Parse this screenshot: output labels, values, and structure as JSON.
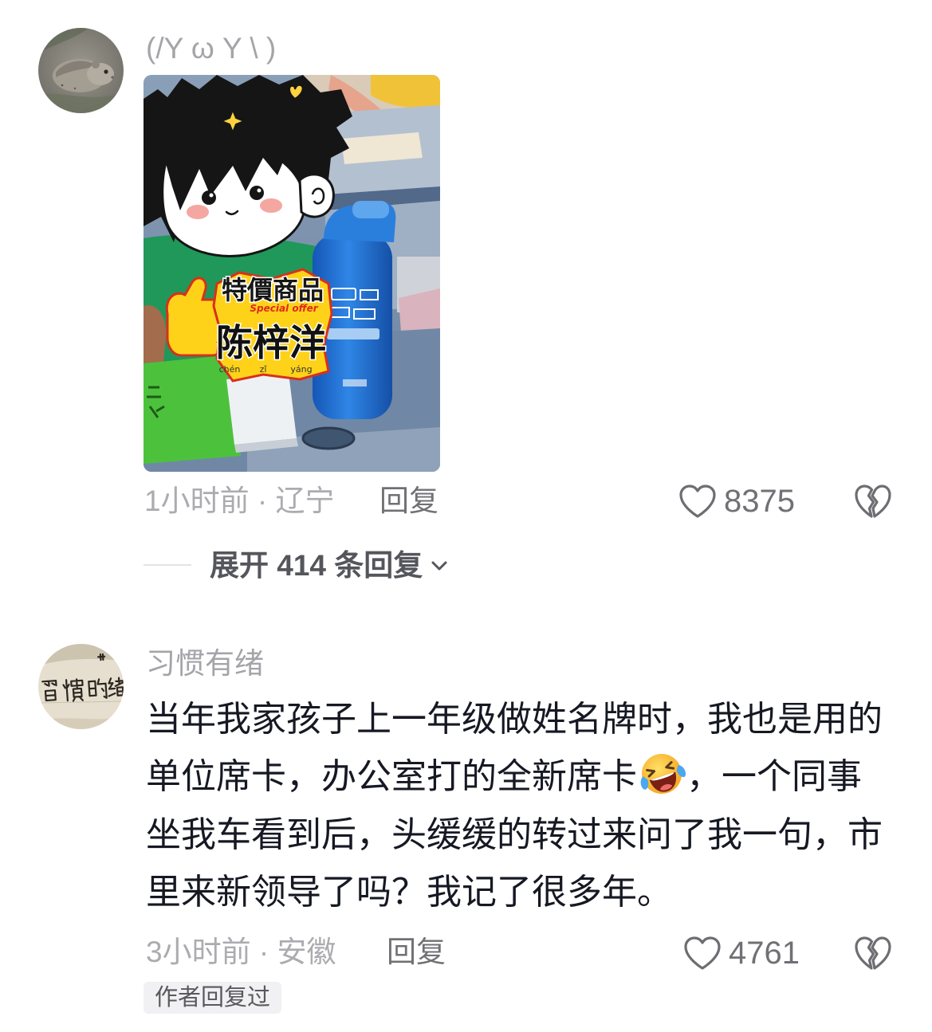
{
  "colors": {
    "text_primary": "#161823",
    "text_secondary": "#a4a4a9",
    "text_tertiary": "#ababb0",
    "text_action": "#707075",
    "text_expand": "#55555c",
    "icon_stroke": "#6d6d72",
    "badge_bg": "#f1f1f3"
  },
  "comments": [
    {
      "avatar": "hamster-photo-avatar",
      "username": "(/Y ω Y \\ )",
      "photo": {
        "sticker_title": "特價商品",
        "sticker_tagline": "Special offer",
        "sticker_name": "陈梓洋",
        "sticker_pinyin": [
          "chén",
          "zǐ",
          "yáng"
        ]
      },
      "meta": "1小时前 · 辽宁",
      "reply_label": "回复",
      "like_icon": "heart-outline-icon",
      "like_count": "8375",
      "dislike_icon": "broken-heart-icon",
      "expand_label": "展开 414 条回复",
      "expand_icon": "chevron-down-icon"
    },
    {
      "avatar": "handwriting-paper-avatar",
      "username": "习惯有绪",
      "body": [
        {
          "text": "当年我家孩子上一年级做姓名牌时，我也是用的"
        },
        {
          "text": "单位席卡，办公室打的全新席卡",
          "emoji": "rolling-on-the-floor-laughing-emoji",
          "after": "，一个同事"
        },
        {
          "text": "坐我车看到后，头缓缓的转过来问了我一句，市"
        },
        {
          "text": "里来新领导了吗？我记了很多年。"
        }
      ],
      "meta": "3小时前 · 安徽",
      "reply_label": "回复",
      "like_icon": "heart-outline-icon",
      "like_count": "4761",
      "dislike_icon": "broken-heart-icon",
      "author_badge": "作者回复过"
    }
  ]
}
